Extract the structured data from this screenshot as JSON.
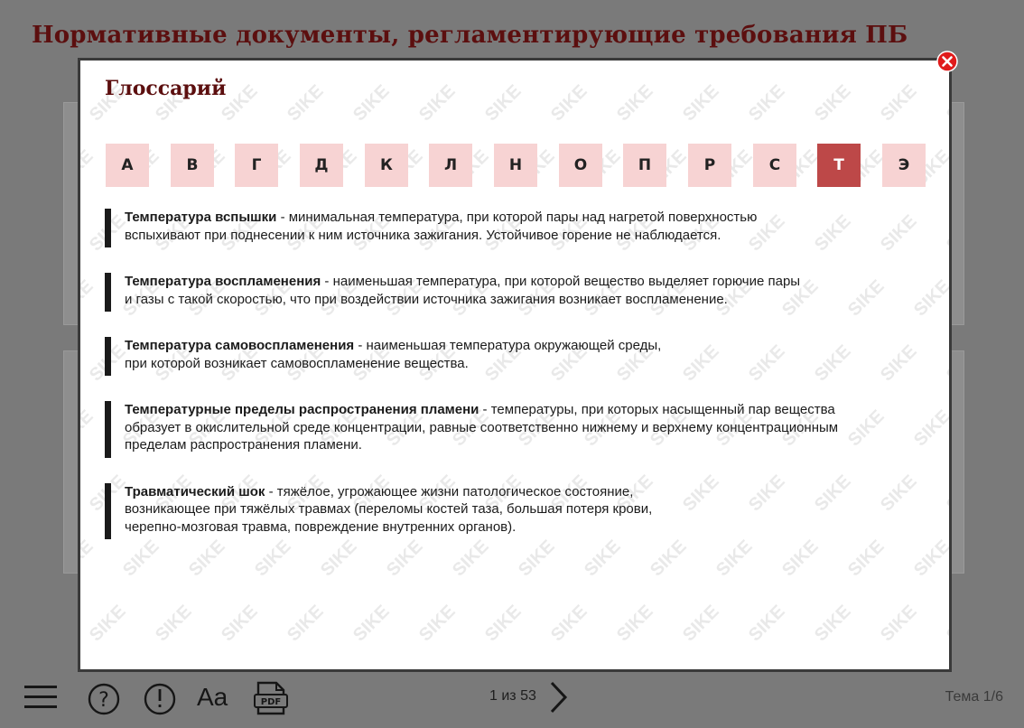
{
  "page": {
    "title": "Нормативные документы, регламентирующие требования ПБ"
  },
  "modal": {
    "title": "Глоссарий",
    "watermark": "SIKE",
    "letters": [
      "А",
      "В",
      "Г",
      "Д",
      "К",
      "Л",
      "Н",
      "О",
      "П",
      "Р",
      "С",
      "Т",
      "Э"
    ],
    "active_letter": "Т",
    "entries": [
      {
        "term": "Температура вспышки",
        "line1": " - минимальная температура, при которой пары над нагретой поверхностью",
        "lines": [
          "вспыхивают при поднесении к ним источника зажигания. Устойчивое горение не наблюдается."
        ]
      },
      {
        "term": "Температура воспламенения",
        "line1": " - наименьшая температура, при которой вещество выделяет горючие пары",
        "lines": [
          "и газы с такой скоростью, что при воздействии источника зажигания возникает воспламенение."
        ]
      },
      {
        "term": "Температура самовоспламенения",
        "line1": " - наименьшая температура окружающей среды,",
        "lines": [
          "при которой возникает самовоспламенение вещества."
        ]
      },
      {
        "term": "Температурные пределы распространения пламени",
        "line1": " - температуры, при которых насыщенный пар вещества",
        "lines": [
          "образует в окислительной среде концентрации, равные соответственно нижнему и верхнему концентрационным",
          "пределам распространения пламени."
        ]
      },
      {
        "term": "Травматический шок",
        "line1": " - тяжёлое, угрожающее жизни патологическое состояние,",
        "lines": [
          "возникающее при тяжёлых травмах (переломы костей таза, большая потеря крови,",
          "черепно-мозговая травма, повреждение внутренних органов)."
        ]
      }
    ]
  },
  "toolbar": {
    "pager": "1 из 53",
    "topic": "Тема 1/6",
    "font_label": "Aa",
    "icons": [
      "menu-icon",
      "help-icon",
      "warning-icon",
      "font-size-icon",
      "pdf-icon",
      "chevron-right-icon"
    ]
  },
  "colors": {
    "accent_dark": "#5c0f0f",
    "letter_bg": "#f7d3d3",
    "letter_active": "#bd4848",
    "close_red": "#e01b1b"
  }
}
